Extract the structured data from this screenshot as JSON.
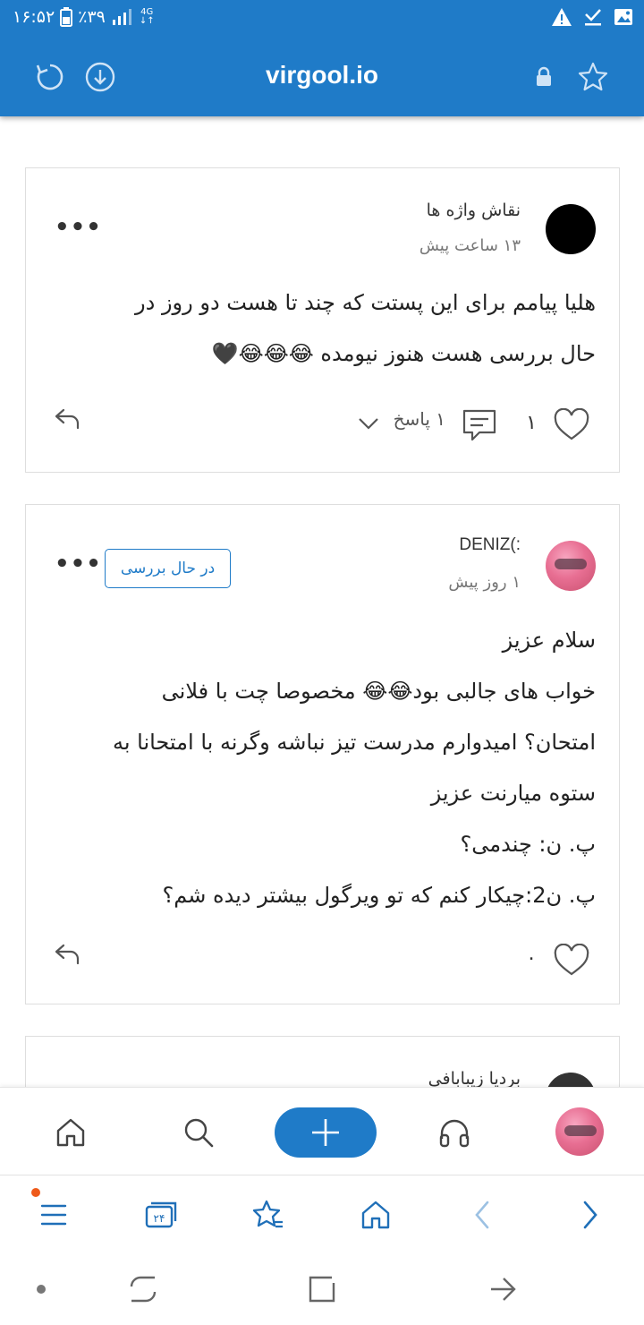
{
  "status_bar": {
    "time": "۱۶:۵۲",
    "battery": "٪۳۹",
    "network": "4G",
    "icons": [
      "battery-icon",
      "signal-icon",
      "network-4g-icon",
      "warning-icon",
      "check-icon",
      "image-icon"
    ]
  },
  "browser": {
    "url": "virgool.io",
    "icons": [
      "refresh-icon",
      "download-icon",
      "lock-icon",
      "star-icon"
    ]
  },
  "comments": [
    {
      "author": "نقاش واژه ها",
      "time_ago": "۱۳ ساعت پیش",
      "lines": [
        "هلیا پیامم برای این پستت که چند تا هست دو روز در",
        "حال بررسی هست هنوز نیومده 😂😂😂🖤"
      ],
      "likes": "۱",
      "replies_count": "۱",
      "replies_label": "پاسخ"
    },
    {
      "author": "DENIZ(:",
      "time_ago": "۱ روز پیش",
      "badge": "در حال بررسی",
      "lines": [
        "سلام عزیز",
        "خواب های جالبی بود😂😂 مخصوصا چت با فلانی",
        "امتحان؟ امیدوارم مدرست تیز نباشه وگرنه با امتحانا به",
        "ستوه میارنت عزیز",
        "پ. ن: چندمی؟",
        "پ. ن2:چیکار کنم که تو ویرگول بیشتر دیده شم؟"
      ],
      "likes": "۰"
    },
    {
      "author": "بردیا زیبابافی"
    }
  ],
  "app_nav": {
    "icons": [
      "home-icon",
      "search-icon",
      "add-icon",
      "headphones-icon",
      "profile-avatar"
    ]
  },
  "browser_toolbar": {
    "tabs_count": "۲۴",
    "icons": [
      "menu-icon",
      "tabs-icon",
      "bookmarks-icon",
      "home-icon",
      "back-icon",
      "forward-icon"
    ]
  },
  "colors": {
    "brand": "#1f7bc8",
    "notification": "#ee5a1a",
    "text": "#222222",
    "muted": "#777777"
  }
}
